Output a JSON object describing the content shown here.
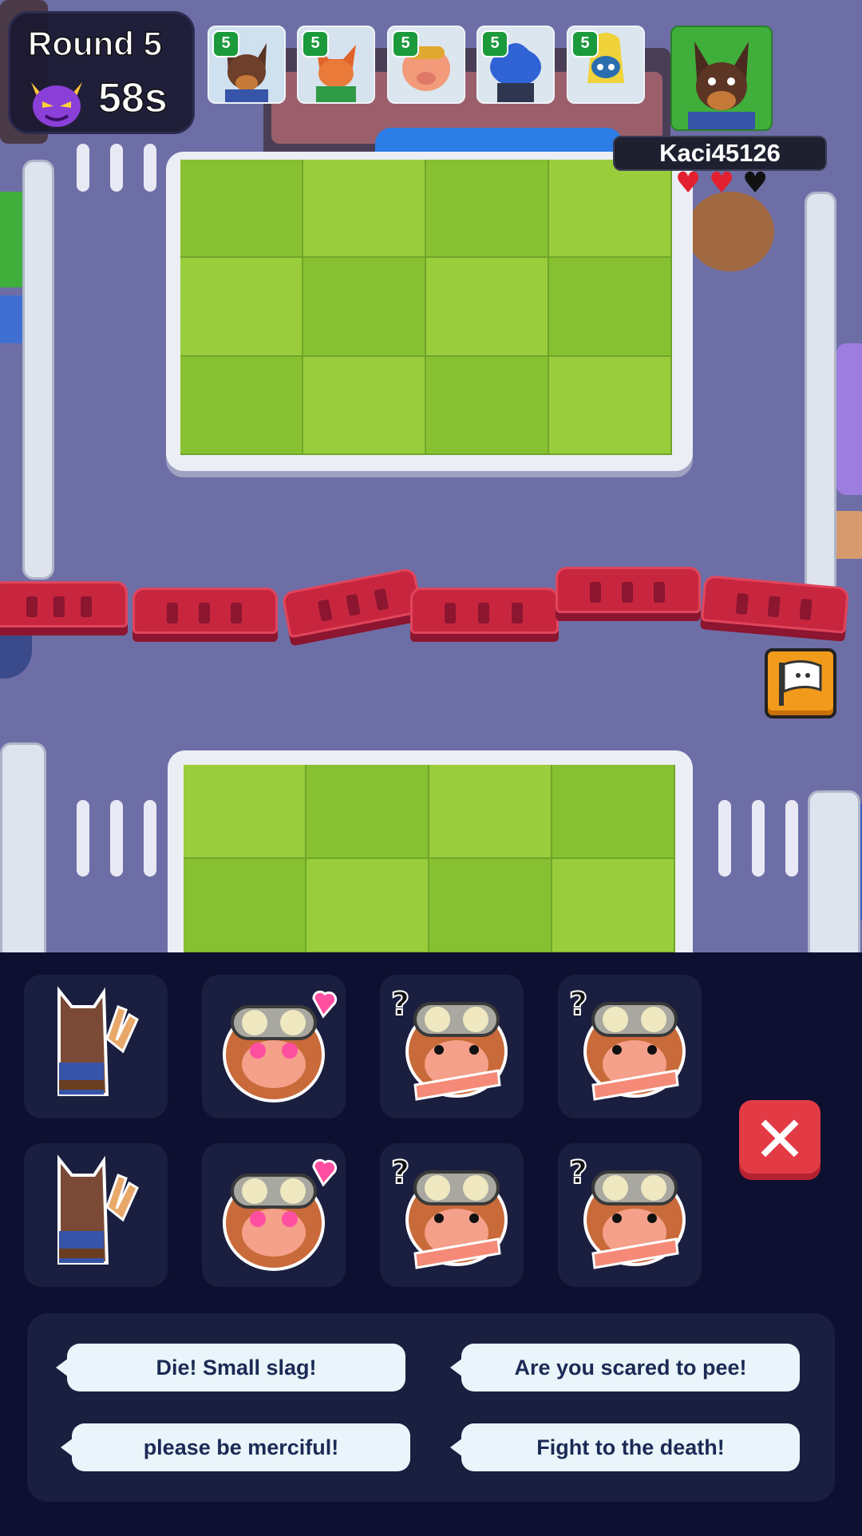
{
  "hud": {
    "round_label": "Round 5",
    "timer": "58s",
    "demon_icon": "purple-demon-icon",
    "team": [
      {
        "level": "5",
        "character": "doberman"
      },
      {
        "level": "5",
        "character": "fox"
      },
      {
        "level": "5",
        "character": "pig-aviator"
      },
      {
        "level": "5",
        "character": "blue-wizard"
      },
      {
        "level": "5",
        "character": "yellow-robot"
      }
    ],
    "opponent": {
      "character": "doberman",
      "name": "Kaci45126",
      "hearts": [
        "full",
        "full",
        "empty"
      ]
    },
    "flag_icon": "surrender-flag-icon"
  },
  "emotes": {
    "items": [
      "wolf-peace-emote",
      "pig-love-emote",
      "pig-confused-emote",
      "pig-confused-emote",
      "wolf-peace-emote",
      "pig-love-emote",
      "pig-confused-emote",
      "pig-confused-emote"
    ],
    "close_icon": "close-x-icon"
  },
  "quick_chat": [
    "Die! Small slag!",
    "Are you scared to pee!",
    "please be merciful!",
    "Fight to the death!"
  ],
  "colors": {
    "heart_full": "#e2202f",
    "heart_empty": "#111111",
    "panel_bg": "#0d1030",
    "close_button": "#e33b46"
  }
}
